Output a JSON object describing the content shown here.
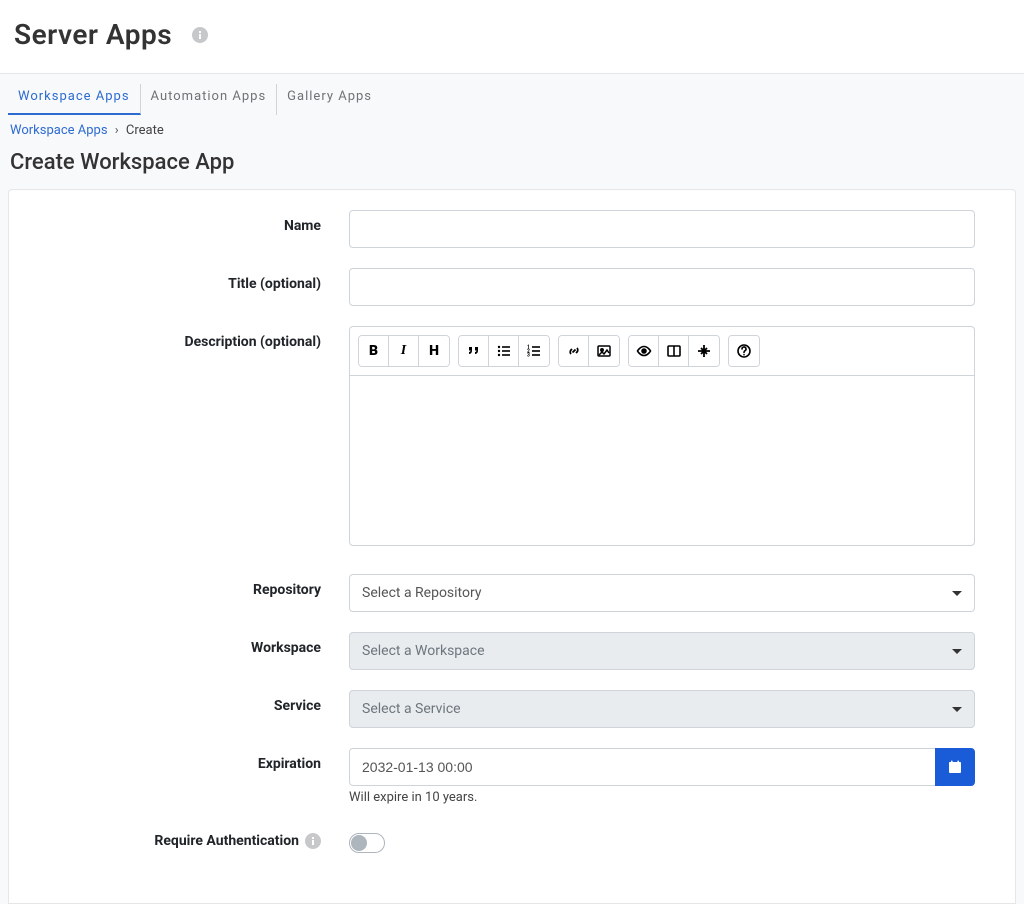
{
  "header": {
    "title": "Server Apps"
  },
  "tabs": [
    {
      "label": "Workspace Apps",
      "active": true
    },
    {
      "label": "Automation Apps",
      "active": false
    },
    {
      "label": "Gallery Apps",
      "active": false
    }
  ],
  "breadcrumb": {
    "root": "Workspace Apps",
    "current": "Create"
  },
  "subheading": "Create Workspace App",
  "form": {
    "labels": {
      "name": "Name",
      "title": "Title (optional)",
      "description": "Description (optional)",
      "repository": "Repository",
      "workspace": "Workspace",
      "service": "Service",
      "expiration": "Expiration",
      "require_auth": "Require Authentication"
    },
    "values": {
      "name": "",
      "title": "",
      "description": "",
      "repository": "Select a Repository",
      "workspace": "Select a Workspace",
      "service": "Select a Service",
      "expiration": "2032-01-13 00:00",
      "require_auth": false
    },
    "helper": {
      "expiration": "Will expire in 10 years."
    }
  },
  "rte_toolbar": {
    "group1": [
      "bold",
      "italic",
      "heading"
    ],
    "group2": [
      "quote",
      "ul",
      "ol"
    ],
    "group3": [
      "link",
      "image"
    ],
    "group4": [
      "preview",
      "columns",
      "fullscreen"
    ],
    "group5": [
      "help"
    ],
    "glyphs": {
      "bold": "B",
      "italic": "I",
      "heading": "H"
    }
  }
}
